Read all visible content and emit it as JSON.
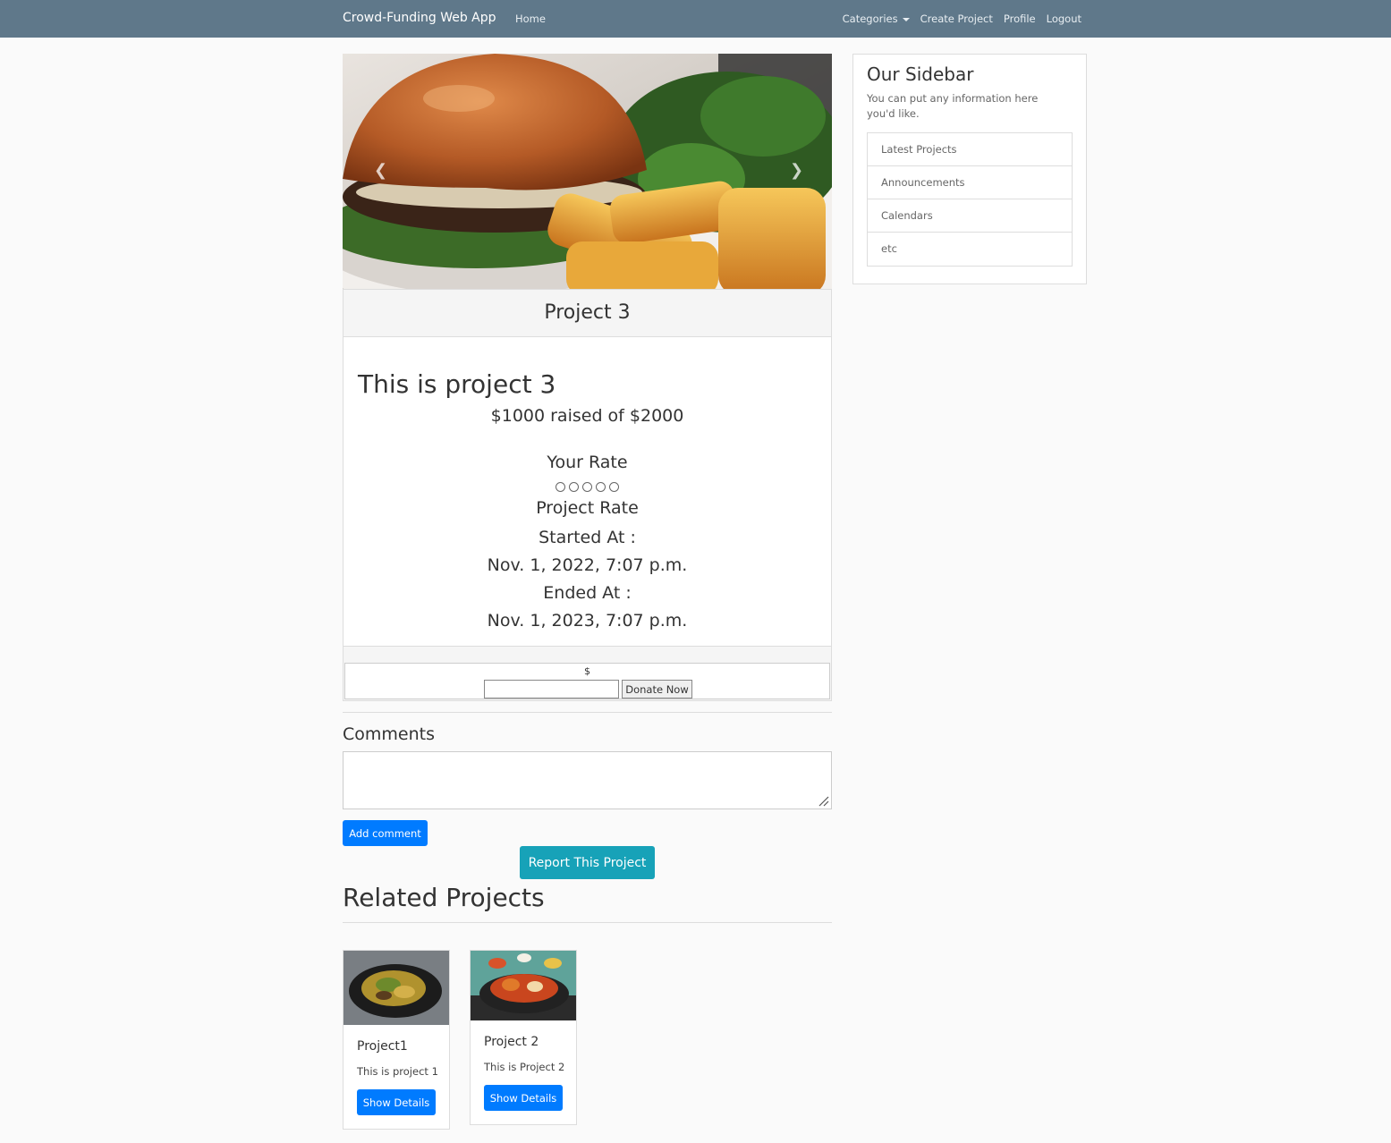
{
  "navbar": {
    "brand": "Crowd-Funding Web App",
    "home": "Home",
    "categories": "Categories",
    "create_project": "Create Project",
    "profile": "Profile",
    "logout": "Logout"
  },
  "project": {
    "header": "Project 3",
    "heading": "This is project 3",
    "raised": "$1000 raised of $2000",
    "your_rate_label": "Your Rate",
    "rating_options": 5,
    "project_rate_label": "Project Rate",
    "started_label": "Started At :",
    "started_value": "Nov. 1, 2022, 7:07 p.m.",
    "ended_label": "Ended At :",
    "ended_value": "Nov. 1, 2023, 7:07 p.m."
  },
  "donate": {
    "currency": "$",
    "button": "Donate Now"
  },
  "comments": {
    "title": "Comments",
    "add_button": "Add comment"
  },
  "report_button": "Report This Project",
  "related": {
    "title": "Related Projects",
    "items": [
      {
        "title": "Project1",
        "text": "This is project 1",
        "button": "Show Details"
      },
      {
        "title": "Project 2",
        "text": "This is Project 2",
        "button": "Show Details"
      }
    ]
  },
  "sidebar": {
    "title": "Our Sidebar",
    "text": "You can put any information here you'd like.",
    "items": [
      "Latest Projects",
      "Announcements",
      "Calendars",
      "etc"
    ]
  },
  "colors": {
    "navbar": "#5f788a",
    "primary": "#007bff",
    "info": "#17a2b8"
  }
}
